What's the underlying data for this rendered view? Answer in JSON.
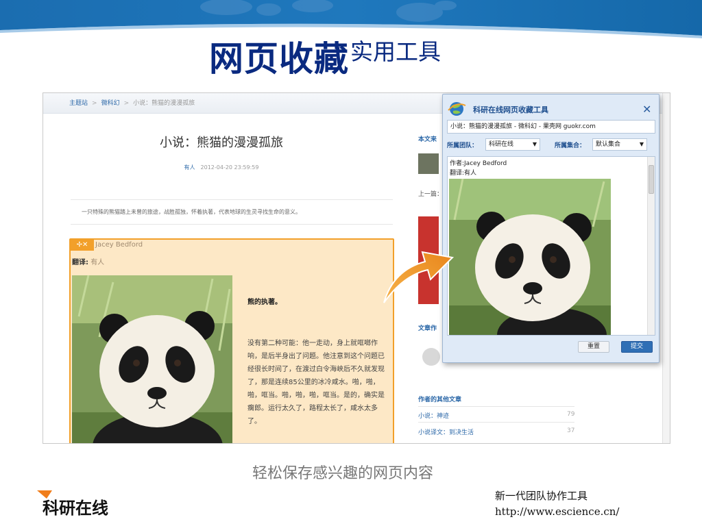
{
  "slide": {
    "title_main": "网页收藏",
    "title_sub": "实用工具",
    "caption": "轻松保存感兴趣的网页内容",
    "footer_tagline": "新一代团队协作工具",
    "footer_url": "http://www.escience.cn/",
    "logo_text": "科研在线",
    "colors": {
      "banner": "#1566a8",
      "title": "#0a2a80",
      "highlight_border": "#f2a02a",
      "highlight_bg": "#fde8c6"
    }
  },
  "page": {
    "breadcrumb": [
      "主题站",
      "微科幻",
      "小说：熊猫的漫漫孤旅"
    ],
    "article_title": "小说：熊猫的漫漫孤旅",
    "article_author": "有人",
    "article_date": "2012-04-20 23:59:59",
    "summary": "一只特殊的熊猫踏上未曾的旅途，战胜孤独，怀着执著，代表地球的生灵寻找生命的意义。",
    "highlight": {
      "tools": "✢✕",
      "author": "Jacey Bedford",
      "translator_label": "翻译:",
      "translator": "有人",
      "heading": "熊的执著。",
      "body": "没有第二种可能：他一走动，身上就哐啷作响，是后半身出了问题。他注意到这个问题已经很长时间了，在渡过白令海峡后不久就发现了，那是连续85公里的冰冷咸水。啪，啪，啪，哐当。啪，啪，啪，哐当。是的，确实是瘸郎。运行太久了，路程太长了，咸水太多了。"
    },
    "right_column": {
      "source_label": "本文来",
      "prev_label": "上一篇：",
      "articles_label": "文章作",
      "other_label": "作者的其他文章",
      "other_items": [
        {
          "title": "小说：神迹",
          "count": "79"
        },
        {
          "title": "小说译文：到决生活",
          "count": "37"
        }
      ]
    }
  },
  "popup": {
    "title": "科研在线网页收藏工具",
    "url_value": "小说：熊猫的漫漫孤旅 - 微科幻 - 果壳网 guokr.com",
    "team_label": "所属团队：",
    "team_value": "科研在线",
    "collection_label": "所属集合：",
    "collection_value": "默认集合",
    "content_author": "作者:Jacey Bedford",
    "content_translator": "翻译:有人",
    "reset_label": "重置",
    "submit_label": "提交",
    "close_icon": "close-icon"
  }
}
